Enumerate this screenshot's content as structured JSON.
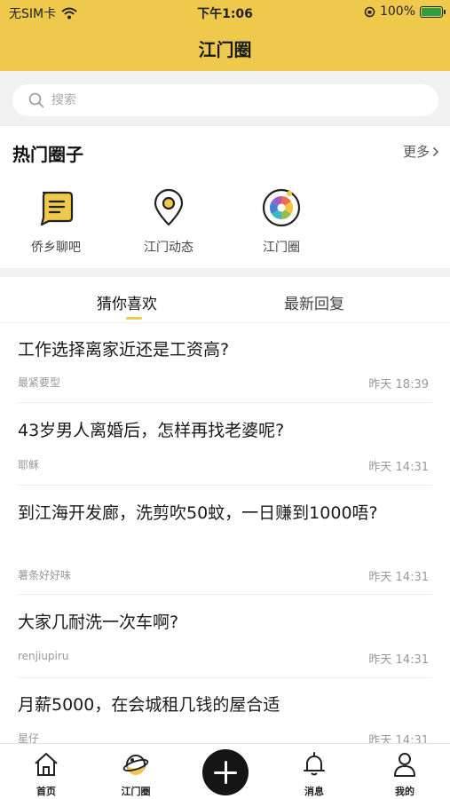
{
  "status_bar": {
    "carrier": "无SIM卡",
    "time": "下午1:06",
    "battery": "100%"
  },
  "header": {
    "title": "江门圈"
  },
  "search": {
    "placeholder": "搜索"
  },
  "hot": {
    "title": "热门圈子",
    "more": "更多",
    "items": [
      {
        "label": "侨乡聊吧",
        "icon": "chat-icon"
      },
      {
        "label": "江门动态",
        "icon": "location-pin-icon"
      },
      {
        "label": "江门圈",
        "icon": "camera-aperture-icon"
      }
    ]
  },
  "tabs": [
    {
      "label": "猜你喜欢",
      "active": true
    },
    {
      "label": "最新回复",
      "active": false
    }
  ],
  "posts": [
    {
      "title": "工作选择离家近还是工资高?",
      "author": "最紧要型",
      "time": "昨天 18:39"
    },
    {
      "title": "43岁男人离婚后，怎样再找老婆呢?",
      "author": "耶稣",
      "time": "昨天 14:31"
    },
    {
      "title": "到江海开发廊，洗剪吹50蚊，一日赚到1000唔?",
      "author": "薯条好好味",
      "time": "昨天 14:31"
    },
    {
      "title": "大家几耐洗一次车啊?",
      "author": "renjiupiru",
      "time": "昨天 14:31"
    },
    {
      "title": "月薪5000，在会城租几钱的屋合适",
      "author": "星仔",
      "time": "昨天 14:31"
    }
  ],
  "tabbar": {
    "items": [
      {
        "label": "首页",
        "icon": "home-icon"
      },
      {
        "label": "江门圈",
        "icon": "planet-icon"
      },
      {
        "label": "",
        "icon": "plus-icon"
      },
      {
        "label": "消息",
        "icon": "bell-icon"
      },
      {
        "label": "我的",
        "icon": "user-icon"
      }
    ]
  },
  "colors": {
    "brand": "#efc94c",
    "text": "#1a1a1a",
    "muted": "#999999"
  }
}
